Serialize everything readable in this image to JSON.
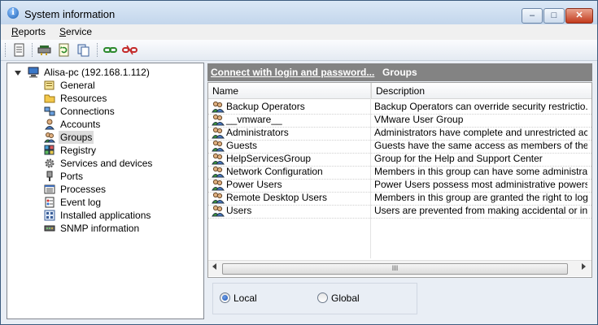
{
  "window": {
    "title": "System information"
  },
  "caption_buttons": {
    "minimize": "–",
    "maximize": "□",
    "close": "✕"
  },
  "menu": [
    {
      "underline": "R",
      "rest": "eports"
    },
    {
      "underline": "S",
      "rest": "ervice"
    }
  ],
  "toolbar": {
    "icons": [
      "report-icon",
      "network-card-icon",
      "refresh-icon",
      "copy-icon",
      "connect-icon",
      "disconnect-icon"
    ]
  },
  "tree": {
    "root": "Alisa-pc (192.168.1.112)",
    "items": [
      "General",
      "Resources",
      "Connections",
      "Accounts",
      "Groups",
      "Registry",
      "Services and devices",
      "Ports",
      "Processes",
      "Event log",
      "Installed applications",
      "SNMP information"
    ],
    "selected": "Groups"
  },
  "header": {
    "connect_link": "Connect with login and password...",
    "section": "Groups"
  },
  "list": {
    "columns": [
      "Name",
      "Description"
    ],
    "rows": [
      {
        "name": "Backup Operators",
        "desc": "Backup Operators can override security restrictio..."
      },
      {
        "name": "__vmware__",
        "desc": "VMware User Group"
      },
      {
        "name": "Administrators",
        "desc": "Administrators have complete and unrestricted ac..."
      },
      {
        "name": "Guests",
        "desc": "Guests have the same access as members of the..."
      },
      {
        "name": "HelpServicesGroup",
        "desc": "Group for the Help and Support Center"
      },
      {
        "name": "Network Configuration",
        "desc": "Members in this group can have some administrat..."
      },
      {
        "name": "Power Users",
        "desc": "Power Users possess most administrative powers..."
      },
      {
        "name": "Remote Desktop Users",
        "desc": "Members in this group are granted the right to log..."
      },
      {
        "name": "Users",
        "desc": "Users are prevented from making accidental or in..."
      }
    ],
    "scrollbar_grip": "III"
  },
  "scope": {
    "options": [
      "Local",
      "Global"
    ],
    "selected": "Local"
  },
  "colors": {
    "header_strip": "#838383",
    "selection": "#dcdcdc",
    "window_bg": "#e9eef5"
  }
}
